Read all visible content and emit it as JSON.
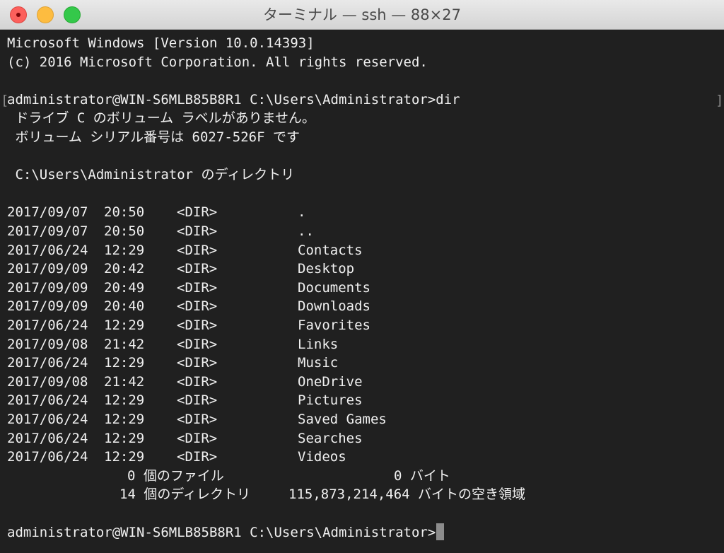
{
  "window": {
    "title": "ターミナル — ssh — 88×27"
  },
  "terminal": {
    "header_line1": "Microsoft Windows [Version 10.0.14393]",
    "header_line2": "(c) 2016 Microsoft Corporation. All rights reserved.",
    "bracket_left": "[",
    "bracket_right": "]",
    "prompt": "administrator@WIN-S6MLB85B8R1 C:\\Users\\Administrator>",
    "command": "dir",
    "volume_label": " ドライブ C のボリューム ラベルがありません。",
    "volume_serial": " ボリューム シリアル番号は 6027-526F です",
    "directory_of": " C:\\Users\\Administrator のディレクトリ",
    "dir_tag": "<DIR>",
    "entries": [
      {
        "date": "2017/09/07",
        "time": "20:50",
        "name": "."
      },
      {
        "date": "2017/09/07",
        "time": "20:50",
        "name": ".."
      },
      {
        "date": "2017/06/24",
        "time": "12:29",
        "name": "Contacts"
      },
      {
        "date": "2017/09/09",
        "time": "20:42",
        "name": "Desktop"
      },
      {
        "date": "2017/09/09",
        "time": "20:49",
        "name": "Documents"
      },
      {
        "date": "2017/09/09",
        "time": "20:40",
        "name": "Downloads"
      },
      {
        "date": "2017/06/24",
        "time": "12:29",
        "name": "Favorites"
      },
      {
        "date": "2017/09/08",
        "time": "21:42",
        "name": "Links"
      },
      {
        "date": "2017/06/24",
        "time": "12:29",
        "name": "Music"
      },
      {
        "date": "2017/09/08",
        "time": "21:42",
        "name": "OneDrive"
      },
      {
        "date": "2017/06/24",
        "time": "12:29",
        "name": "Pictures"
      },
      {
        "date": "2017/06/24",
        "time": "12:29",
        "name": "Saved Games"
      },
      {
        "date": "2017/06/24",
        "time": "12:29",
        "name": "Searches"
      },
      {
        "date": "2017/06/24",
        "time": "12:29",
        "name": "Videos"
      }
    ],
    "summary_files_count": "0 個のファイル",
    "summary_files_bytes": "0 バイト",
    "summary_dirs_count": "14 個のディレクトリ",
    "summary_dirs_free": "115,873,214,464 バイトの空き領域",
    "final_prompt": "administrator@WIN-S6MLB85B8R1 C:\\Users\\Administrator>"
  }
}
